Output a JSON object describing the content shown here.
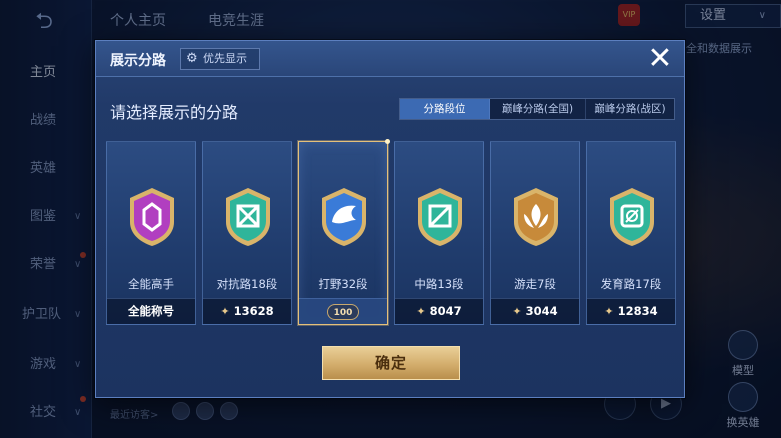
{
  "background": {
    "back_icon": "back-arrow-icon",
    "top_tabs": [
      "个人主页",
      "电竞生涯"
    ],
    "settings_label": "设置",
    "vip_label": "VIP",
    "bg_data_link": "全和数据展示",
    "nav_items": [
      {
        "label": "主页",
        "active": true
      },
      {
        "label": "战绩",
        "active": false
      },
      {
        "label": "英雄",
        "active": false
      },
      {
        "label": "图鉴",
        "active": false
      },
      {
        "label": "荣誉",
        "active": false
      },
      {
        "label": "护卫队",
        "active": false
      },
      {
        "label": "游戏",
        "active": false
      },
      {
        "label": "社交",
        "active": false
      }
    ],
    "recent_visitors_label": "最近访客>",
    "model_label": "模型",
    "change_hero_label": "换英雄"
  },
  "modal": {
    "title": "展示分路",
    "priority_button_label": "优先显示",
    "priority_icon": "gear-icon",
    "close_icon": "close-icon",
    "subtitle": "请选择展示的分路",
    "segment_tabs": [
      {
        "label": "分路段位",
        "active": true
      },
      {
        "label": "巅峰分路(全国)",
        "active": false
      },
      {
        "label": "巅峰分路(战区)",
        "active": false
      }
    ],
    "cards": [
      {
        "label": "全能高手",
        "footer": "全能称号",
        "footer_icon": "",
        "color": "#b13fc0",
        "selected": false
      },
      {
        "label": "对抗路18段",
        "footer": "13628",
        "footer_icon": "rank-points-icon",
        "color": "#2fb59a",
        "selected": false
      },
      {
        "label": "打野32段",
        "footer": "100",
        "footer_icon": "badge-icon",
        "color": "#3a7bd8",
        "selected": true
      },
      {
        "label": "中路13段",
        "footer": "8047",
        "footer_icon": "rank-points-icon",
        "color": "#2fb59a",
        "selected": false
      },
      {
        "label": "游走7段",
        "footer": "3044",
        "footer_icon": "rank-points-icon",
        "color": "#c78a3a",
        "selected": false
      },
      {
        "label": "发育路17段",
        "footer": "12834",
        "footer_icon": "rank-points-icon",
        "color": "#2fb59a",
        "selected": false
      }
    ],
    "confirm_label": "确定"
  }
}
